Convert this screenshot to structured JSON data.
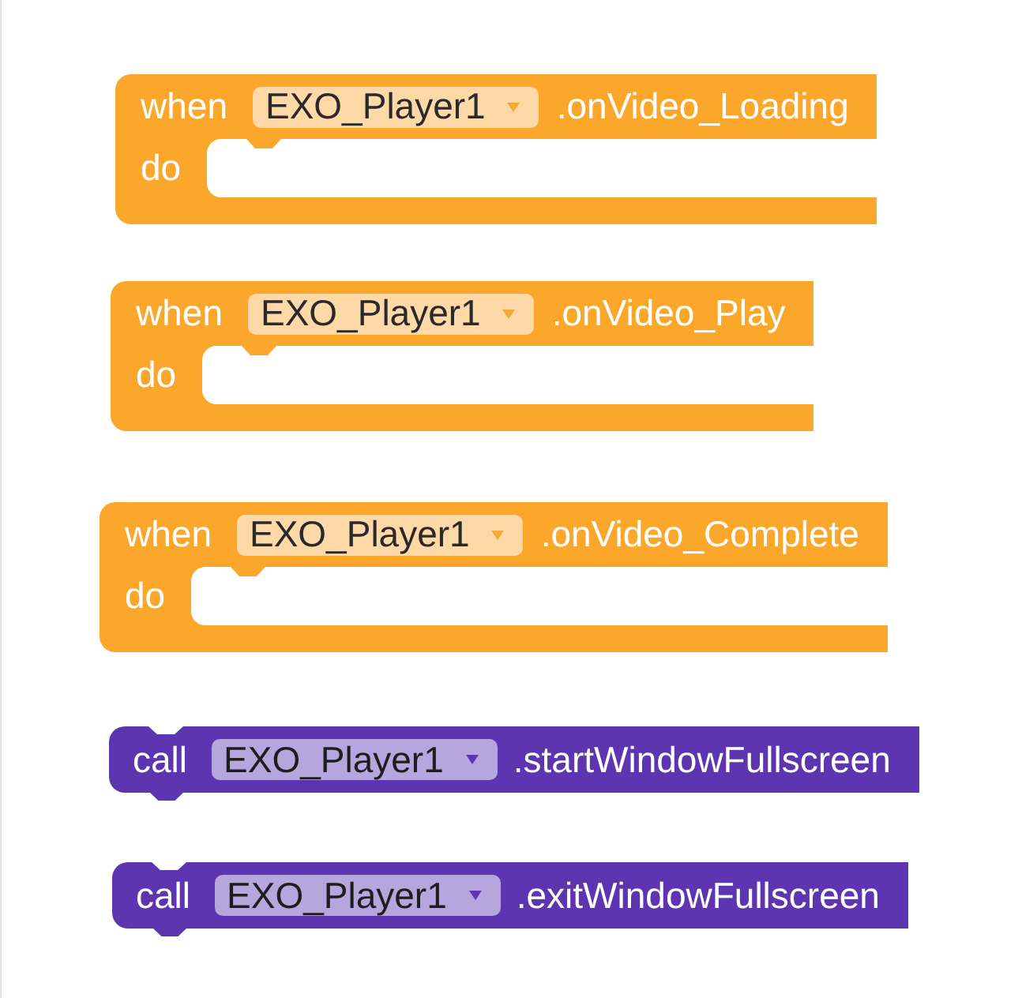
{
  "workspace": {
    "blocks": [
      {
        "kind": "event",
        "keyword": "when",
        "component": "EXO_Player1",
        "member": ".onVideo_Loading",
        "body_label": "do"
      },
      {
        "kind": "event",
        "keyword": "when",
        "component": "EXO_Player1",
        "member": ".onVideo_Play",
        "body_label": "do"
      },
      {
        "kind": "event",
        "keyword": "when",
        "component": "EXO_Player1",
        "member": ".onVideo_Complete",
        "body_label": "do"
      },
      {
        "kind": "method",
        "keyword": "call",
        "component": "EXO_Player1",
        "member": ".startWindowFullscreen"
      },
      {
        "kind": "method",
        "keyword": "call",
        "component": "EXO_Player1",
        "member": ".exitWindowFullscreen"
      }
    ]
  }
}
